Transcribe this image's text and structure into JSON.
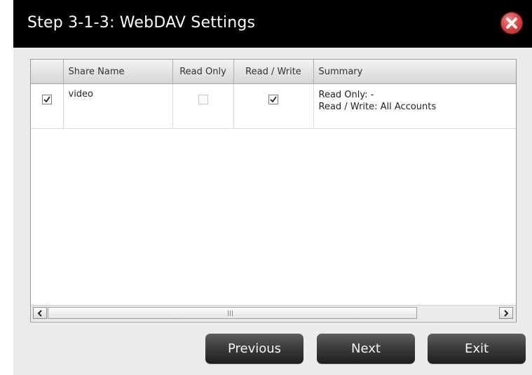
{
  "dialog": {
    "title": "Step 3-1-3: WebDAV Settings",
    "close_icon": "close-icon"
  },
  "table": {
    "columns": [
      "",
      "Share Name",
      "Read Only",
      "Read / Write",
      "Summary"
    ],
    "rows": [
      {
        "selected": true,
        "share_name": "video",
        "read_only": false,
        "read_write": true,
        "summary_line1": "Read Only: -",
        "summary_line2": "Read / Write: All Accounts"
      }
    ]
  },
  "scrollbar": {
    "left_icon": "chevron-left-icon",
    "right_icon": "chevron-right-icon"
  },
  "buttons": {
    "previous": "Previous",
    "next": "Next",
    "exit": "Exit"
  },
  "colors": {
    "titlebar": "#000000",
    "dialog_bg": "#ebebeb",
    "button_dark": "#2a2a2a",
    "close_red": "#d84444"
  }
}
